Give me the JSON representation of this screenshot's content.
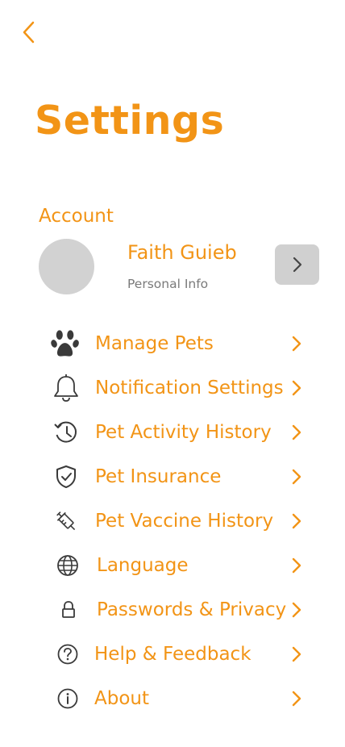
{
  "header": {
    "title": "Settings",
    "back_icon": "chevron-left-icon"
  },
  "account": {
    "section_label": "Account",
    "name": "Faith Guieb",
    "subtitle": "Personal Info"
  },
  "menu": [
    {
      "label": "Manage Pets",
      "icon": "paw-icon"
    },
    {
      "label": "Notification Settings",
      "icon": "bell-icon"
    },
    {
      "label": "Pet Activity History",
      "icon": "history-icon"
    },
    {
      "label": "Pet Insurance",
      "icon": "shield-check-icon"
    },
    {
      "label": "Pet Vaccine History",
      "icon": "syringe-icon"
    },
    {
      "label": "Language",
      "icon": "globe-icon"
    },
    {
      "label": "Passwords & Privacy",
      "icon": "lock-icon"
    },
    {
      "label": "Help & Feedback",
      "icon": "question-circle-icon"
    },
    {
      "label": "About",
      "icon": "info-circle-icon"
    }
  ],
  "colors": {
    "accent": "#f29416",
    "icon": "#3a3a3a",
    "avatar": "#d2d2d2",
    "button": "#d0d0d0",
    "subtitle": "#7a7a7a"
  }
}
